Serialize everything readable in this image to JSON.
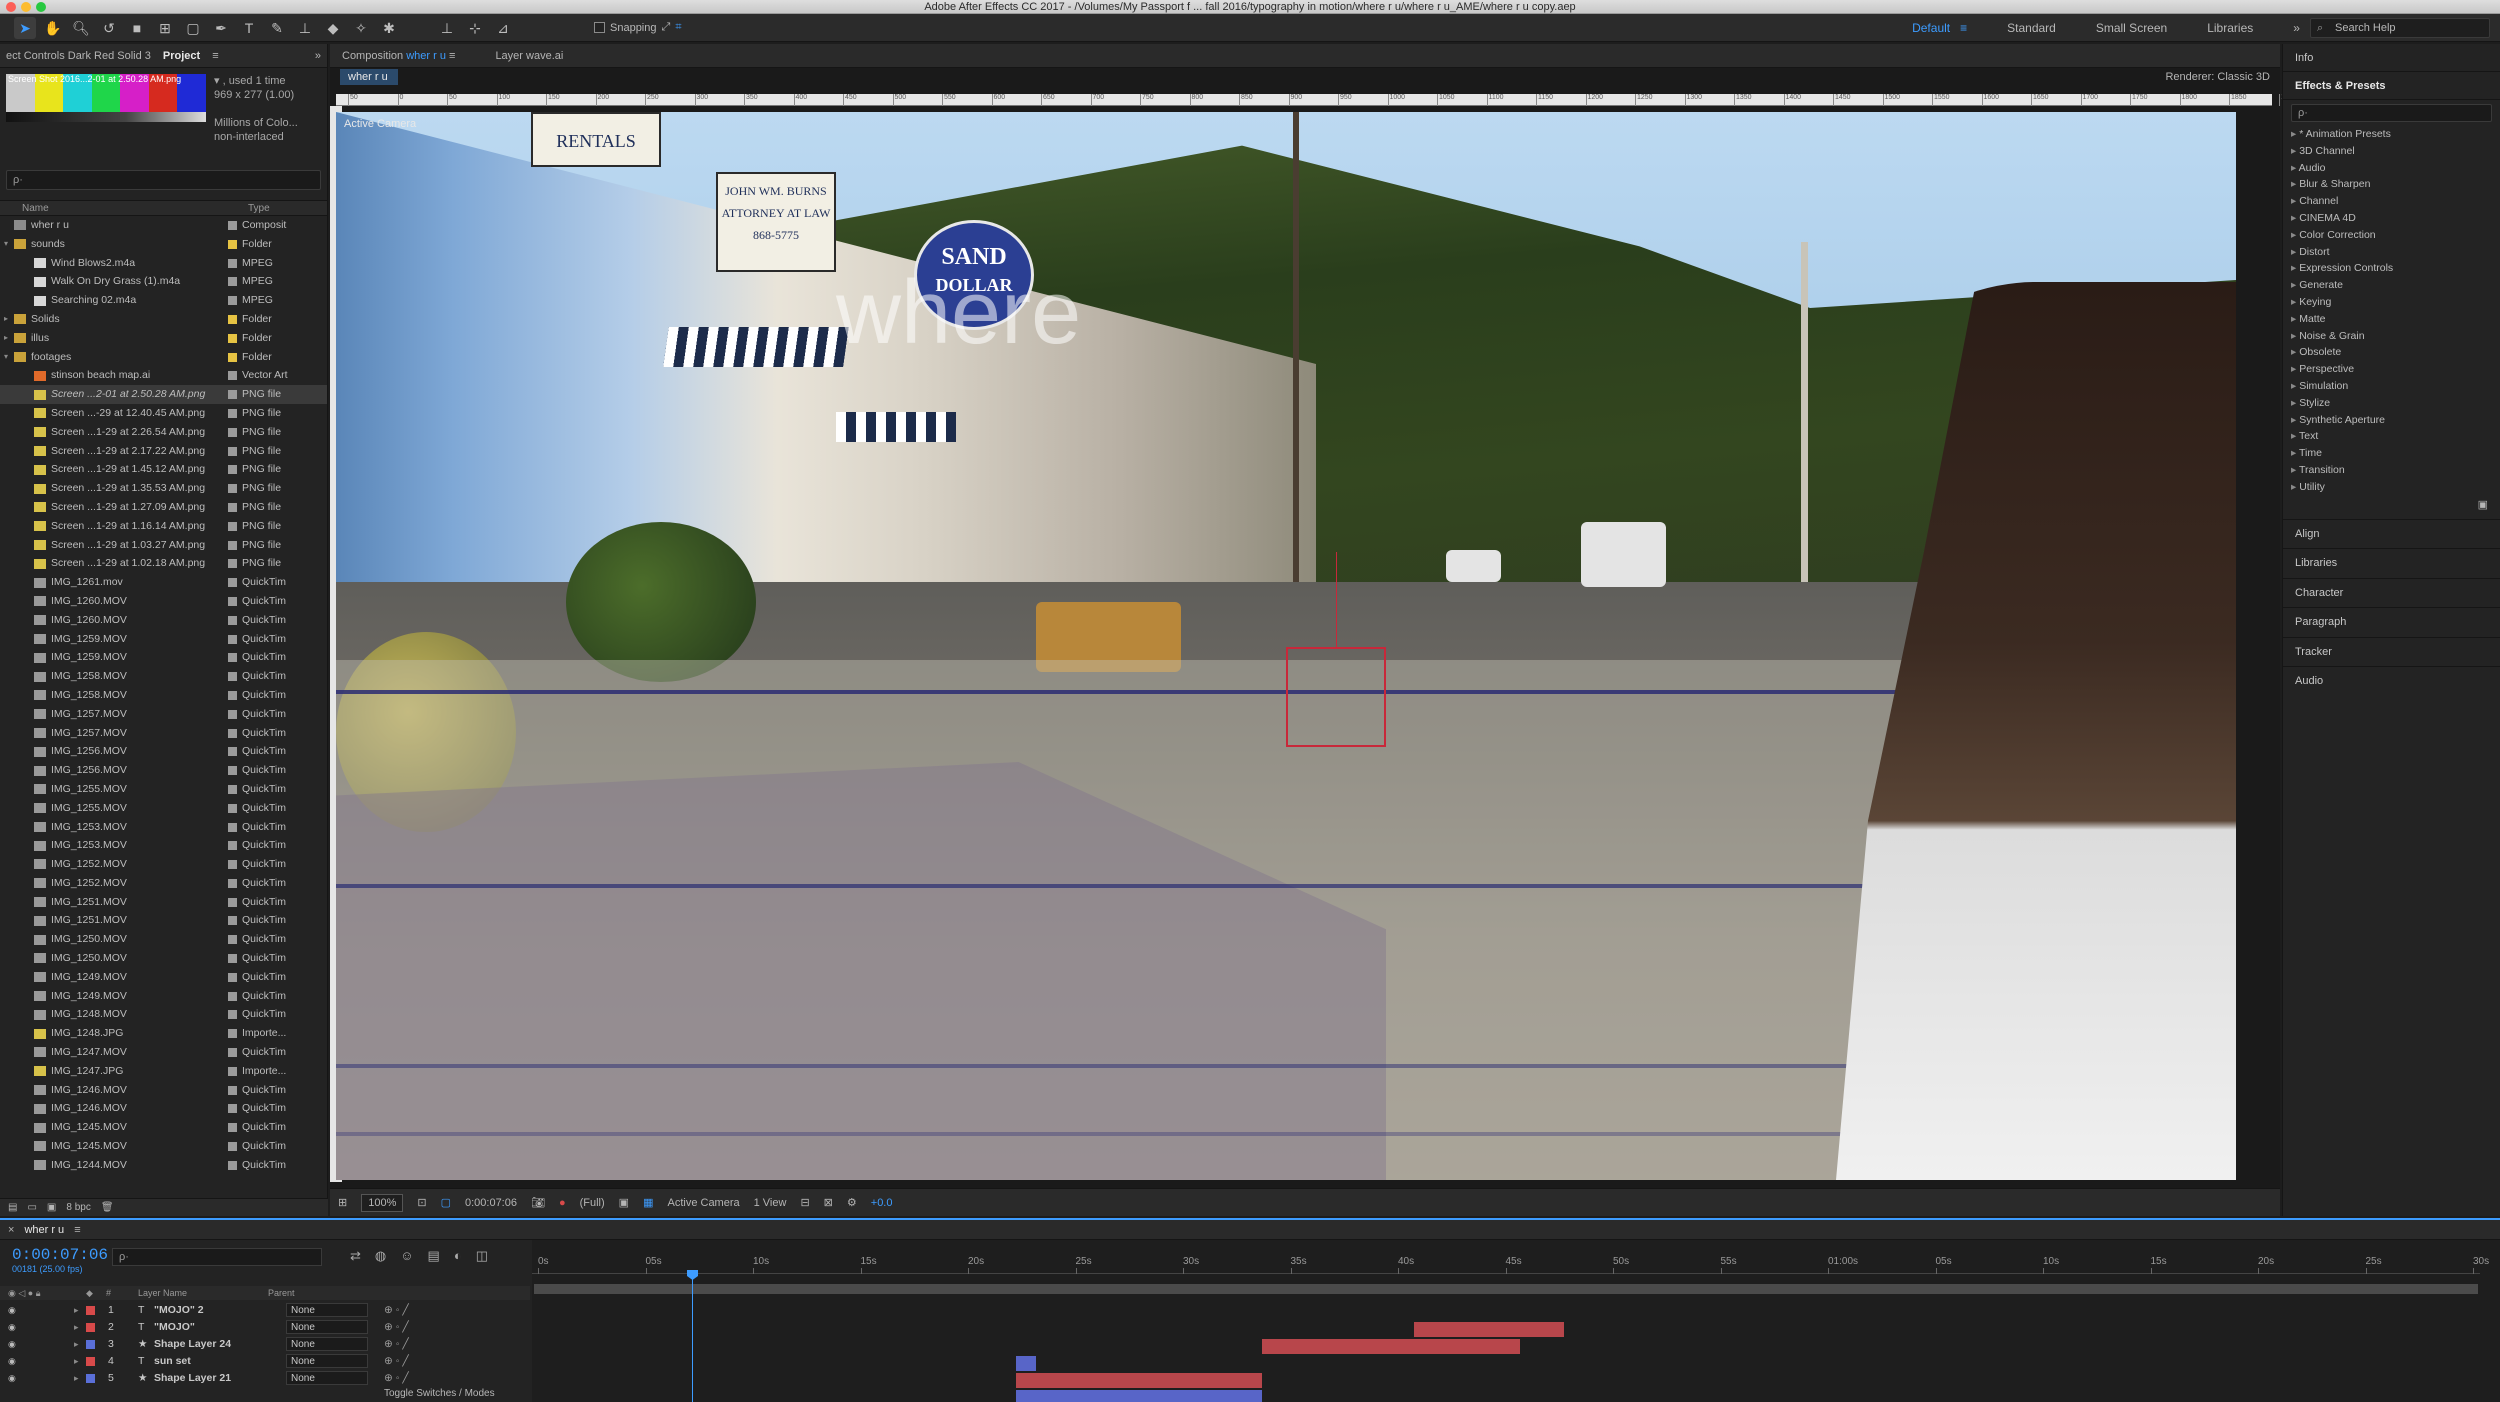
{
  "window": {
    "title": "Adobe After Effects CC 2017 - /Volumes/My Passport f ... fall 2016/typography in motion/where r u/where r u_AME/where r u copy.aep"
  },
  "toolbar": {
    "snapping_label": "Snapping",
    "workspaces": [
      "Default",
      "Standard",
      "Small Screen",
      "Libraries"
    ],
    "active_workspace": "Default",
    "search_help_placeholder": "Search Help"
  },
  "project_panel": {
    "tab_effect_controls": "ect Controls Dark Red Solid 3",
    "tab_project": "Project",
    "thumb_label": "Screen Shot 2016...2-01 at 2.50.28 AM.png",
    "info_used": "▾ , used 1 time",
    "info_size": "969 x 277 (1.00)",
    "info_color": "Millions of Colo...",
    "info_interlace": "non-interlaced",
    "search_placeholder": "ρ·",
    "col_name": "Name",
    "col_type": "Type",
    "bpc": "8 bpc",
    "items": [
      {
        "name": "wher r u",
        "type": "Composit",
        "label": "#9b9b9b",
        "icon": "comp",
        "indent": 0
      },
      {
        "name": "sounds",
        "type": "Folder",
        "label": "#e6c343",
        "icon": "folder",
        "indent": 0,
        "twisty": "▾"
      },
      {
        "name": "Wind Blows2.m4a",
        "type": "MPEG",
        "label": "#9b9b9b",
        "icon": "file",
        "indent": 1
      },
      {
        "name": "Walk On Dry Grass (1).m4a",
        "type": "MPEG",
        "label": "#9b9b9b",
        "icon": "file",
        "indent": 1
      },
      {
        "name": "Searching 02.m4a",
        "type": "MPEG",
        "label": "#9b9b9b",
        "icon": "file",
        "indent": 1
      },
      {
        "name": "Solids",
        "type": "Folder",
        "label": "#e6c343",
        "icon": "folder",
        "indent": 0,
        "twisty": "▸"
      },
      {
        "name": "illus",
        "type": "Folder",
        "label": "#e6c343",
        "icon": "folder",
        "indent": 0,
        "twisty": "▸"
      },
      {
        "name": "footages",
        "type": "Folder",
        "label": "#e6c343",
        "icon": "folder",
        "indent": 0,
        "twisty": "▾"
      },
      {
        "name": "stinson beach map.ai",
        "type": "Vector Art",
        "label": "#9b9b9b",
        "icon": "ai",
        "indent": 1
      },
      {
        "name": "Screen ...2-01 at 2.50.28 AM.png",
        "type": "PNG file",
        "label": "#9b9b9b",
        "icon": "png",
        "indent": 1,
        "selected": true
      },
      {
        "name": "Screen ...-29 at 12.40.45 AM.png",
        "type": "PNG file",
        "label": "#9b9b9b",
        "icon": "png",
        "indent": 1
      },
      {
        "name": "Screen ...1-29 at 2.26.54 AM.png",
        "type": "PNG file",
        "label": "#9b9b9b",
        "icon": "png",
        "indent": 1
      },
      {
        "name": "Screen ...1-29 at 2.17.22 AM.png",
        "type": "PNG file",
        "label": "#9b9b9b",
        "icon": "png",
        "indent": 1
      },
      {
        "name": "Screen ...1-29 at 1.45.12 AM.png",
        "type": "PNG file",
        "label": "#9b9b9b",
        "icon": "png",
        "indent": 1
      },
      {
        "name": "Screen ...1-29 at 1.35.53 AM.png",
        "type": "PNG file",
        "label": "#9b9b9b",
        "icon": "png",
        "indent": 1
      },
      {
        "name": "Screen ...1-29 at 1.27.09 AM.png",
        "type": "PNG file",
        "label": "#9b9b9b",
        "icon": "png",
        "indent": 1
      },
      {
        "name": "Screen ...1-29 at 1.16.14 AM.png",
        "type": "PNG file",
        "label": "#9b9b9b",
        "icon": "png",
        "indent": 1
      },
      {
        "name": "Screen ...1-29 at 1.03.27 AM.png",
        "type": "PNG file",
        "label": "#9b9b9b",
        "icon": "png",
        "indent": 1
      },
      {
        "name": "Screen ...1-29 at 1.02.18 AM.png",
        "type": "PNG file",
        "label": "#9b9b9b",
        "icon": "png",
        "indent": 1
      },
      {
        "name": "IMG_1261.mov",
        "type": "QuickTim",
        "label": "#9b9b9b",
        "icon": "mov",
        "indent": 1
      },
      {
        "name": "IMG_1260.MOV",
        "type": "QuickTim",
        "label": "#9b9b9b",
        "icon": "mov",
        "indent": 1
      },
      {
        "name": "IMG_1260.MOV",
        "type": "QuickTim",
        "label": "#9b9b9b",
        "icon": "mov",
        "indent": 1
      },
      {
        "name": "IMG_1259.MOV",
        "type": "QuickTim",
        "label": "#9b9b9b",
        "icon": "mov",
        "indent": 1
      },
      {
        "name": "IMG_1259.MOV",
        "type": "QuickTim",
        "label": "#9b9b9b",
        "icon": "mov",
        "indent": 1
      },
      {
        "name": "IMG_1258.MOV",
        "type": "QuickTim",
        "label": "#9b9b9b",
        "icon": "mov",
        "indent": 1
      },
      {
        "name": "IMG_1258.MOV",
        "type": "QuickTim",
        "label": "#9b9b9b",
        "icon": "mov",
        "indent": 1
      },
      {
        "name": "IMG_1257.MOV",
        "type": "QuickTim",
        "label": "#9b9b9b",
        "icon": "mov",
        "indent": 1
      },
      {
        "name": "IMG_1257.MOV",
        "type": "QuickTim",
        "label": "#9b9b9b",
        "icon": "mov",
        "indent": 1
      },
      {
        "name": "IMG_1256.MOV",
        "type": "QuickTim",
        "label": "#9b9b9b",
        "icon": "mov",
        "indent": 1
      },
      {
        "name": "IMG_1256.MOV",
        "type": "QuickTim",
        "label": "#9b9b9b",
        "icon": "mov",
        "indent": 1
      },
      {
        "name": "IMG_1255.MOV",
        "type": "QuickTim",
        "label": "#9b9b9b",
        "icon": "mov",
        "indent": 1
      },
      {
        "name": "IMG_1255.MOV",
        "type": "QuickTim",
        "label": "#9b9b9b",
        "icon": "mov",
        "indent": 1
      },
      {
        "name": "IMG_1253.MOV",
        "type": "QuickTim",
        "label": "#9b9b9b",
        "icon": "mov",
        "indent": 1
      },
      {
        "name": "IMG_1253.MOV",
        "type": "QuickTim",
        "label": "#9b9b9b",
        "icon": "mov",
        "indent": 1
      },
      {
        "name": "IMG_1252.MOV",
        "type": "QuickTim",
        "label": "#9b9b9b",
        "icon": "mov",
        "indent": 1
      },
      {
        "name": "IMG_1252.MOV",
        "type": "QuickTim",
        "label": "#9b9b9b",
        "icon": "mov",
        "indent": 1
      },
      {
        "name": "IMG_1251.MOV",
        "type": "QuickTim",
        "label": "#9b9b9b",
        "icon": "mov",
        "indent": 1
      },
      {
        "name": "IMG_1251.MOV",
        "type": "QuickTim",
        "label": "#9b9b9b",
        "icon": "mov",
        "indent": 1
      },
      {
        "name": "IMG_1250.MOV",
        "type": "QuickTim",
        "label": "#9b9b9b",
        "icon": "mov",
        "indent": 1
      },
      {
        "name": "IMG_1250.MOV",
        "type": "QuickTim",
        "label": "#9b9b9b",
        "icon": "mov",
        "indent": 1
      },
      {
        "name": "IMG_1249.MOV",
        "type": "QuickTim",
        "label": "#9b9b9b",
        "icon": "mov",
        "indent": 1
      },
      {
        "name": "IMG_1249.MOV",
        "type": "QuickTim",
        "label": "#9b9b9b",
        "icon": "mov",
        "indent": 1
      },
      {
        "name": "IMG_1248.MOV",
        "type": "QuickTim",
        "label": "#9b9b9b",
        "icon": "mov",
        "indent": 1
      },
      {
        "name": "IMG_1248.JPG",
        "type": "Importe...",
        "label": "#9b9b9b",
        "icon": "png",
        "indent": 1
      },
      {
        "name": "IMG_1247.MOV",
        "type": "QuickTim",
        "label": "#9b9b9b",
        "icon": "mov",
        "indent": 1
      },
      {
        "name": "IMG_1247.JPG",
        "type": "Importe...",
        "label": "#9b9b9b",
        "icon": "png",
        "indent": 1
      },
      {
        "name": "IMG_1246.MOV",
        "type": "QuickTim",
        "label": "#9b9b9b",
        "icon": "mov",
        "indent": 1
      },
      {
        "name": "IMG_1246.MOV",
        "type": "QuickTim",
        "label": "#9b9b9b",
        "icon": "mov",
        "indent": 1
      },
      {
        "name": "IMG_1245.MOV",
        "type": "QuickTim",
        "label": "#9b9b9b",
        "icon": "mov",
        "indent": 1
      },
      {
        "name": "IMG_1245.MOV",
        "type": "QuickTim",
        "label": "#9b9b9b",
        "icon": "mov",
        "indent": 1
      },
      {
        "name": "IMG_1244.MOV",
        "type": "QuickTim",
        "label": "#9b9b9b",
        "icon": "mov",
        "indent": 1
      }
    ]
  },
  "composition": {
    "tab_label": "Composition",
    "tab_name": "wher r u",
    "tab_layer": "Layer wave.ai",
    "breadcrumb": "wher r u",
    "renderer_label": "Renderer:",
    "renderer_value": "Classic 3D",
    "camera_label": "Active Camera",
    "ghost_text": "where",
    "sign_sand": "SAND",
    "sign_dollar": "DOLLAR",
    "sign_rentals": "RENTALS",
    "sign_attorney": "JOHN WM. BURNS\nATTORNEY AT LAW\n868-5775",
    "ruler_numbers": [
      "50",
      "0",
      "50",
      "100",
      "150",
      "200",
      "250",
      "300",
      "350",
      "400",
      "450",
      "500",
      "550",
      "600",
      "650",
      "700",
      "750",
      "800",
      "850",
      "900",
      "950",
      "1000",
      "1050",
      "1100",
      "1150",
      "1200",
      "1250",
      "1300",
      "1350",
      "1400",
      "1450",
      "1500",
      "1550",
      "1600",
      "1650",
      "1700",
      "1750",
      "1800",
      "1850",
      "1900"
    ],
    "zoom": "100%",
    "timecode": "0:00:07:06",
    "resolution": "(Full)",
    "view_camera": "Active Camera",
    "view_count": "1 View",
    "exposure": "+0.0"
  },
  "right_panel": {
    "info": "Info",
    "effects_title": "Effects & Presets",
    "effects_search": "ρ·",
    "effects": [
      "* Animation Presets",
      "3D Channel",
      "Audio",
      "Blur & Sharpen",
      "Channel",
      "CINEMA 4D",
      "Color Correction",
      "Distort",
      "Expression Controls",
      "Generate",
      "Keying",
      "Matte",
      "Noise & Grain",
      "Obsolete",
      "Perspective",
      "Simulation",
      "Stylize",
      "Synthetic Aperture",
      "Text",
      "Time",
      "Transition",
      "Utility"
    ],
    "sections": [
      "Align",
      "Libraries",
      "Character",
      "Paragraph",
      "Tracker",
      "Audio"
    ]
  },
  "timeline": {
    "tab": "wher r u",
    "current_time": "0:00:07:06",
    "frames": "00181 (25.00 fps)",
    "search_placeholder": "ρ·",
    "col_layer_name": "Layer Name",
    "col_parent": "Parent",
    "ticks": [
      "0s",
      "05s",
      "10s",
      "15s",
      "20s",
      "25s",
      "30s",
      "35s",
      "40s",
      "45s",
      "50s",
      "55s",
      "01:00s",
      "05s",
      "10s",
      "15s",
      "20s",
      "25s",
      "30s"
    ],
    "layers": [
      {
        "num": "1",
        "type": "T",
        "name": "\"MOJO\" 2",
        "color": "#d84a4a",
        "parent": "None"
      },
      {
        "num": "2",
        "type": "T",
        "name": "\"MOJO\"",
        "color": "#d84a4a",
        "parent": "None"
      },
      {
        "num": "3",
        "type": "★",
        "name": "Shape Layer 24",
        "color": "#5a6fd8",
        "parent": "None"
      },
      {
        "num": "4",
        "type": "T",
        "name": "sun set",
        "color": "#d84a4a",
        "parent": "None"
      },
      {
        "num": "5",
        "type": "★",
        "name": "Shape Layer 21",
        "color": "#5a6fd8",
        "parent": "None"
      }
    ],
    "toggle_label": "Toggle Switches / Modes"
  }
}
